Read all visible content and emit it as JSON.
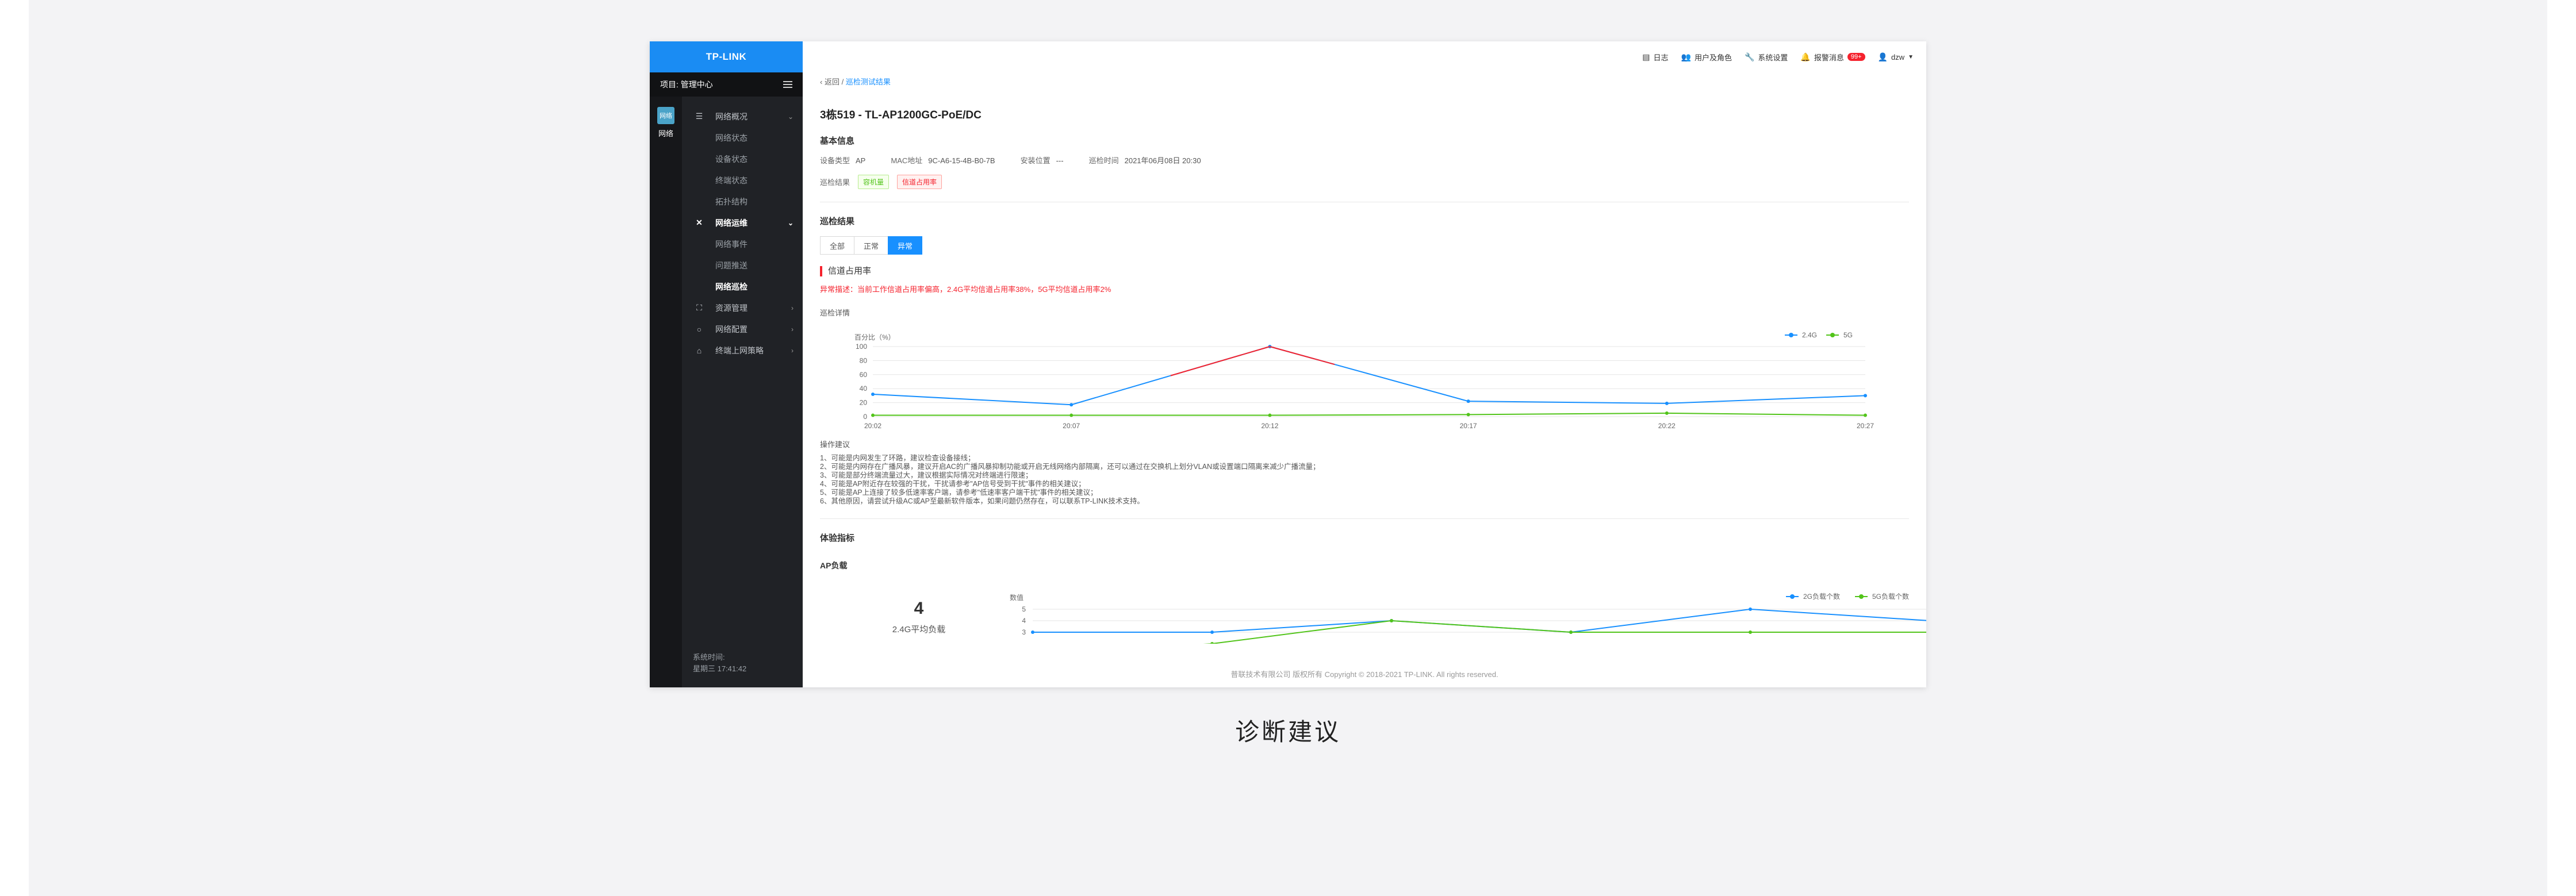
{
  "sidebar": {
    "logo": "TP-LINK",
    "project_label": "项目: 管理中心",
    "rail": {
      "badge": "网络",
      "label": "网络"
    },
    "groups": [
      {
        "label": "网络概况",
        "icon": "list-icon",
        "sub": [
          "网络状态",
          "设备状态",
          "终端状态",
          "拓扑结构"
        ]
      },
      {
        "label": "网络运维",
        "icon": "tools-icon",
        "sub": [
          "网络事件",
          "问题推送",
          "网络巡检"
        ]
      },
      {
        "label": "资源管理",
        "icon": "tree-icon",
        "sub": []
      },
      {
        "label": "网络配置",
        "icon": "circle-icon",
        "sub": []
      },
      {
        "label": "终端上网策略",
        "icon": "bank-icon",
        "sub": []
      }
    ],
    "system_time_label": "系统时间:",
    "system_time_value": "星期三 17:41:42"
  },
  "topbar": {
    "log": "日志",
    "users": "用户及角色",
    "settings": "系统设置",
    "alarm": "报警消息",
    "alarm_badge": "99+",
    "user": "dzw"
  },
  "breadcrumb": {
    "back": "返回",
    "separator": " / ",
    "current": "巡检测试结果"
  },
  "device_title": "3栋519 - TL-AP1200GC-PoE/DC",
  "basic": {
    "title": "基本信息",
    "device_type_label": "设备类型",
    "device_type": "AP",
    "mac_label": "MAC地址",
    "mac": "9C-A6-15-4B-B0-7B",
    "location_label": "安装位置",
    "location": "---",
    "time_label": "巡检时间",
    "time": "2021年06月08日 20:30",
    "result_label": "巡检结果",
    "tag_ok": "容机量",
    "tag_bad": "信道占用率"
  },
  "inspect": {
    "title": "巡检结果",
    "filters": [
      "全部",
      "正常",
      "异常"
    ],
    "active_filter": "异常",
    "issue_title": "信道占用率",
    "issue_desc": "异常描述：当前工作信道占用率偏高，2.4G平均信道占用率38%，5G平均信道占用率2%",
    "detail_label": "巡检详情"
  },
  "chart_data": [
    {
      "type": "line",
      "title": "",
      "ylabel": "百分比（%）",
      "x": [
        "20:02",
        "20:07",
        "20:12",
        "20:17",
        "20:22",
        "20:27"
      ],
      "ylim": [
        0,
        100
      ],
      "yticks": [
        0,
        20,
        40,
        60,
        80,
        100
      ],
      "legend_position": "top-right",
      "series": [
        {
          "name": "2.4G",
          "color": "#1890ff",
          "values": [
            32,
            17,
            100,
            22,
            19,
            30
          ]
        },
        {
          "name": "5G",
          "color": "#52c41a",
          "values": [
            2,
            2,
            2,
            3,
            5,
            2
          ]
        }
      ],
      "highlight_color": "#f5222d"
    },
    {
      "type": "line",
      "title": "",
      "ylabel": "数值",
      "yticks": [
        3,
        4,
        5
      ],
      "legend_position": "top-right",
      "series": [
        {
          "name": "2G负载个数",
          "color": "#1890ff",
          "values": [
            3,
            3,
            4,
            3,
            5,
            4
          ]
        },
        {
          "name": "5G负载个数",
          "color": "#52c41a",
          "values": [
            1,
            2,
            4,
            3,
            3,
            3
          ]
        }
      ]
    }
  ],
  "suggestions": {
    "title": "操作建议",
    "items": [
      "1、可能是内网发生了环路，建议检查设备接线；",
      "2、可能是内网存在广播风暴，建议开启AC的广播风暴抑制功能或开启无线网络内部隔离，还可以通过在交换机上划分VLAN或设置端口隔离来减少广播流量；",
      "3、可能是部分终端流量过大，建议根据实际情况对终端进行限速；",
      "4、可能是AP附近存在较强的干扰，干扰请参考\"AP信号受到干扰\"事件的相关建议；",
      "5、可能是AP上连接了较多低速率客户端，请参考\"低速率客户端干扰\"事件的相关建议；",
      "6、其他原因，请尝试升级AC或AP至最新软件版本，如果问题仍然存在，可以联系TP-LINK技术支持。"
    ]
  },
  "experience": {
    "title": "体验指标",
    "ap_load_title": "AP负载",
    "ap_metric_value": "4",
    "ap_metric_caption": "2.4G平均负载"
  },
  "footer": "普联技术有限公司 版权所有 Copyright © 2018-2021 TP-LINK. All rights reserved.",
  "caption": "诊断建议"
}
